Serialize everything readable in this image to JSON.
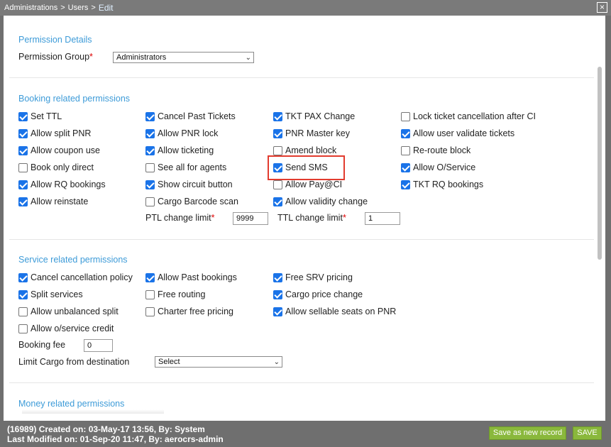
{
  "breadcrumb": {
    "part1": "Administrations",
    "part2": "Users",
    "current": "Edit",
    "separator": ">"
  },
  "close_icon": "×",
  "permission_details": {
    "title": "Permission Details",
    "group_label": "Permission Group",
    "required_mark": "*",
    "group_value": "Administrators"
  },
  "booking": {
    "title": "Booking related permissions",
    "items": [
      {
        "label": "Set TTL",
        "checked": true
      },
      {
        "label": "Cancel Past Tickets",
        "checked": true
      },
      {
        "label": "TKT PAX Change",
        "checked": true
      },
      {
        "label": "Lock ticket cancellation after CI",
        "checked": false
      },
      {
        "label": "Allow split PNR",
        "checked": true
      },
      {
        "label": "Allow PNR lock",
        "checked": true
      },
      {
        "label": "PNR Master key",
        "checked": true
      },
      {
        "label": "Allow user validate tickets",
        "checked": true
      },
      {
        "label": "Allow coupon use",
        "checked": true
      },
      {
        "label": "Allow ticketing",
        "checked": true
      },
      {
        "label": "Amend block",
        "checked": false
      },
      {
        "label": "Re-route block",
        "checked": false
      },
      {
        "label": "Book only direct",
        "checked": false
      },
      {
        "label": "See all for agents",
        "checked": false
      },
      {
        "label": "Send SMS",
        "checked": true
      },
      {
        "label": "Allow O/Service",
        "checked": true
      },
      {
        "label": "Allow RQ bookings",
        "checked": true
      },
      {
        "label": "Show circuit button",
        "checked": true
      },
      {
        "label": "Allow Pay@CI",
        "checked": false
      },
      {
        "label": "TKT RQ bookings",
        "checked": true
      },
      {
        "label": "Allow reinstate",
        "checked": true
      },
      {
        "label": "Cargo Barcode scan",
        "checked": false
      },
      {
        "label": "Allow validity change",
        "checked": true
      }
    ],
    "ptl_label": "PTL change limit",
    "ptl_value": "9999",
    "ttl_label": "TTL change limit",
    "ttl_value": "1"
  },
  "service": {
    "title": "Service related permissions",
    "items": [
      {
        "label": "Cancel cancellation policy",
        "checked": true
      },
      {
        "label": "Allow Past bookings",
        "checked": true
      },
      {
        "label": "Free SRV pricing",
        "checked": true
      },
      {
        "label": "Split services",
        "checked": true
      },
      {
        "label": "Free routing",
        "checked": false
      },
      {
        "label": "Cargo price change",
        "checked": true
      },
      {
        "label": "Allow unbalanced split",
        "checked": false
      },
      {
        "label": "Charter free pricing",
        "checked": false
      },
      {
        "label": "Allow sellable seats on PNR",
        "checked": true
      },
      {
        "label": "Allow o/service credit",
        "checked": false
      }
    ],
    "booking_fee_label": "Booking fee",
    "booking_fee_value": "0",
    "cargo_label": "Limit Cargo from destination",
    "cargo_value": "Select"
  },
  "money": {
    "title": "Money related permissions"
  },
  "footer": {
    "created": "(16989) Created on: 03-May-17 13:56, By: System",
    "modified": "Last Modified on: 01-Sep-20 11:47, By: aerocrs-admin",
    "save_new_label": "Save as new record",
    "save_label": "SAVE"
  }
}
